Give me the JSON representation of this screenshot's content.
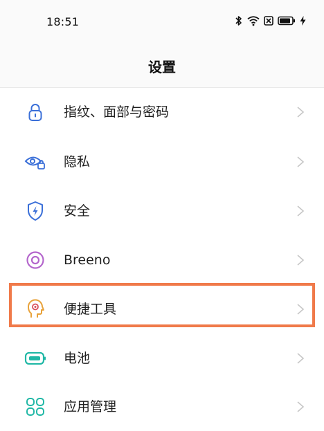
{
  "status_bar": {
    "time": "18:51",
    "icons": [
      "bluetooth-icon",
      "wifi-icon",
      "sim-disabled-icon",
      "battery-icon",
      "charging-icon"
    ]
  },
  "header": {
    "title": "设置"
  },
  "settings": {
    "items": [
      {
        "label": "指纹、面部与密码",
        "icon": "lock-icon"
      },
      {
        "label": "隐私",
        "icon": "privacy-eye-lock-icon"
      },
      {
        "label": "安全",
        "icon": "security-shield-icon"
      },
      {
        "label": "Breeno",
        "icon": "breeno-icon"
      },
      {
        "label": "便捷工具",
        "icon": "convenience-tools-icon"
      },
      {
        "label": "电池",
        "icon": "battery-settings-icon"
      },
      {
        "label": "应用管理",
        "icon": "app-management-icon"
      }
    ]
  },
  "colors": {
    "highlight": "#f07a4a",
    "blue_icon": "#3a6fd8",
    "purple_icon": "#b466cc",
    "orange_icon": "#e8a23a",
    "teal_icon": "#21b8a6",
    "chevron": "#c7c7c7"
  }
}
